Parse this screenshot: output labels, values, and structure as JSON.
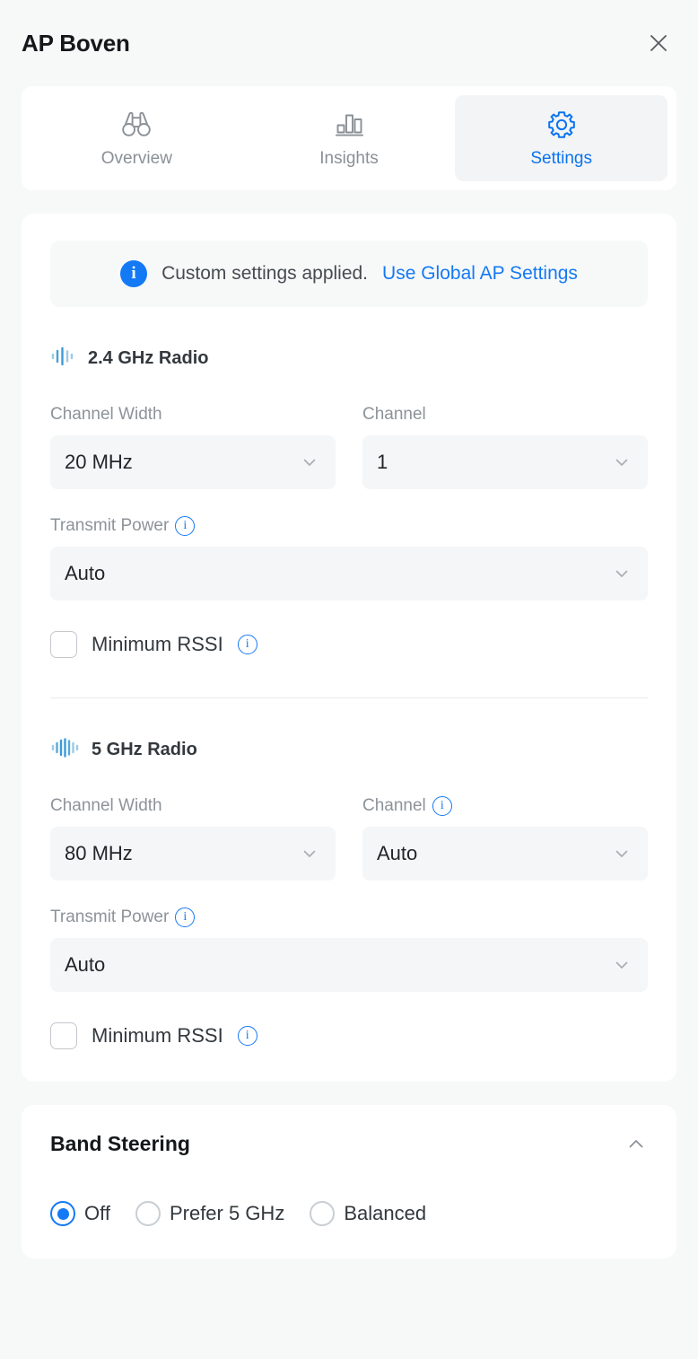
{
  "header": {
    "title": "AP Boven",
    "close_icon": "close-icon"
  },
  "tabs": [
    {
      "label": "Overview",
      "icon": "binoculars-icon",
      "active": false
    },
    {
      "label": "Insights",
      "icon": "bar-chart-icon",
      "active": false
    },
    {
      "label": "Settings",
      "icon": "gear-icon",
      "active": true
    }
  ],
  "banner": {
    "icon": "info-filled-icon",
    "text": "Custom settings applied.",
    "link_label": "Use Global AP Settings"
  },
  "radios": [
    {
      "icon": "signal-waveform-icon",
      "title": "2.4 GHz Radio",
      "channel_width": {
        "label": "Channel Width",
        "value": "20 MHz",
        "has_info": false
      },
      "channel": {
        "label": "Channel",
        "value": "1",
        "has_info": false
      },
      "transmit_power": {
        "label": "Transmit Power",
        "value": "Auto",
        "has_info": true
      },
      "minimum_rssi": {
        "label": "Minimum RSSI",
        "checked": false,
        "has_info": true
      }
    },
    {
      "icon": "signal-waveform-icon",
      "title": "5 GHz Radio",
      "channel_width": {
        "label": "Channel Width",
        "value": "80 MHz",
        "has_info": false
      },
      "channel": {
        "label": "Channel",
        "value": "Auto",
        "has_info": true
      },
      "transmit_power": {
        "label": "Transmit Power",
        "value": "Auto",
        "has_info": true
      },
      "minimum_rssi": {
        "label": "Minimum RSSI",
        "checked": false,
        "has_info": true
      }
    }
  ],
  "band_steering": {
    "title": "Band Steering",
    "collapse_icon": "chevron-up-icon",
    "options": [
      {
        "label": "Off",
        "selected": true
      },
      {
        "label": "Prefer 5 GHz",
        "selected": false
      },
      {
        "label": "Balanced",
        "selected": false
      }
    ]
  },
  "colors": {
    "accent": "#1479f5",
    "tab_active_text": "#0a73f0",
    "page_bg": "#f7f8f8",
    "card_bg": "#ffffff",
    "field_bg": "#f5f6f7",
    "label_gray": "#8d9399",
    "divider": "#e8eaec",
    "waveform_blue": "#3d9bd6",
    "waveform_light": "#9cc9e4"
  }
}
